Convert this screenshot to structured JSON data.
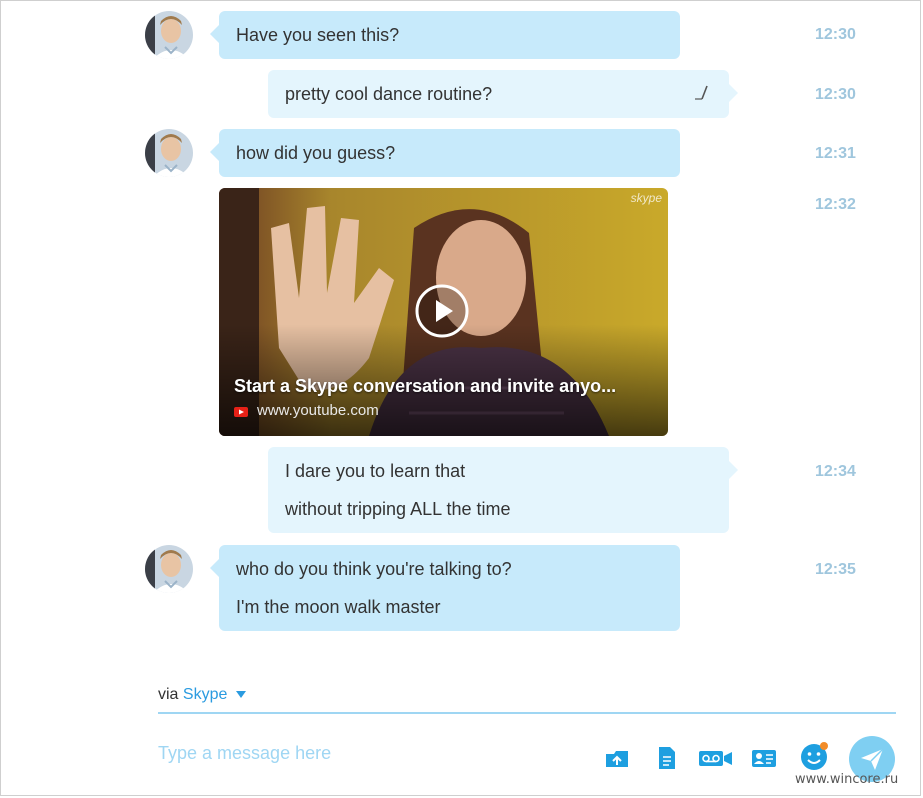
{
  "messages": [
    {
      "lines": [
        "Have you seen this?"
      ],
      "time": "12:30"
    },
    {
      "lines": [
        "pretty cool dance routine?"
      ],
      "time": "12:30"
    },
    {
      "lines": [
        "how did you guess?"
      ],
      "time": "12:31"
    },
    {
      "time": "12:32"
    },
    {
      "lines": [
        "I dare you to learn that",
        "without tripping ALL the time"
      ],
      "time": "12:34"
    },
    {
      "lines": [
        "who do you think you're talking to?",
        "I'm the moon walk master"
      ],
      "time": "12:35"
    }
  ],
  "video": {
    "title": "Start a Skype conversation and invite anyo...",
    "source": "www.youtube.com",
    "watermark": "skype"
  },
  "composer": {
    "via_prefix": "via",
    "via_service": "Skype",
    "placeholder": "Type a message here"
  },
  "watermark": "www.wincore.ru",
  "colors": {
    "incoming_bubble": "#c7eafb",
    "outgoing_bubble": "#e4f5fd",
    "accent": "#2a9be0",
    "time": "#9fc6dd"
  }
}
